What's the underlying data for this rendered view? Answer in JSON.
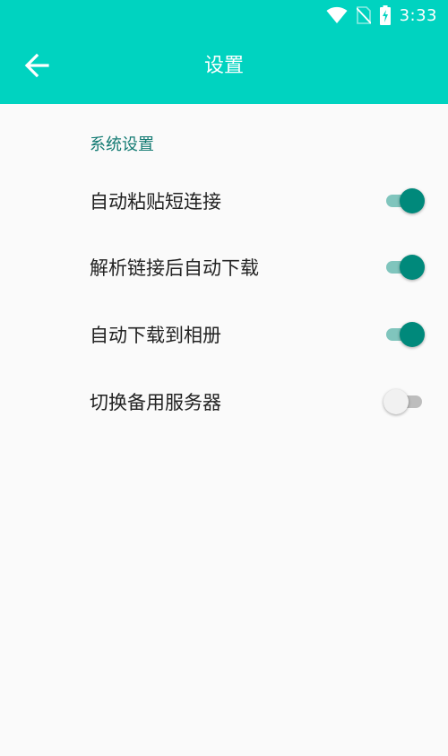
{
  "status_bar": {
    "time": "3:33",
    "icons": [
      "wifi-icon",
      "no-sim-icon",
      "battery-charging-icon"
    ]
  },
  "toolbar": {
    "title": "设置",
    "back_icon": "arrow-back-icon",
    "background": "#00d3c0"
  },
  "section": {
    "title": "系统设置"
  },
  "settings": [
    {
      "label": "自动粘贴短连接",
      "on": true
    },
    {
      "label": "解析链接后自动下载",
      "on": true
    },
    {
      "label": "自动下载到相册",
      "on": true
    },
    {
      "label": "切换备用服务器",
      "on": false
    }
  ],
  "colors": {
    "accent": "#00d3c0",
    "switch_on_thumb": "#00897b",
    "switch_on_track": "#80c5bd",
    "section_header": "#127a72"
  }
}
